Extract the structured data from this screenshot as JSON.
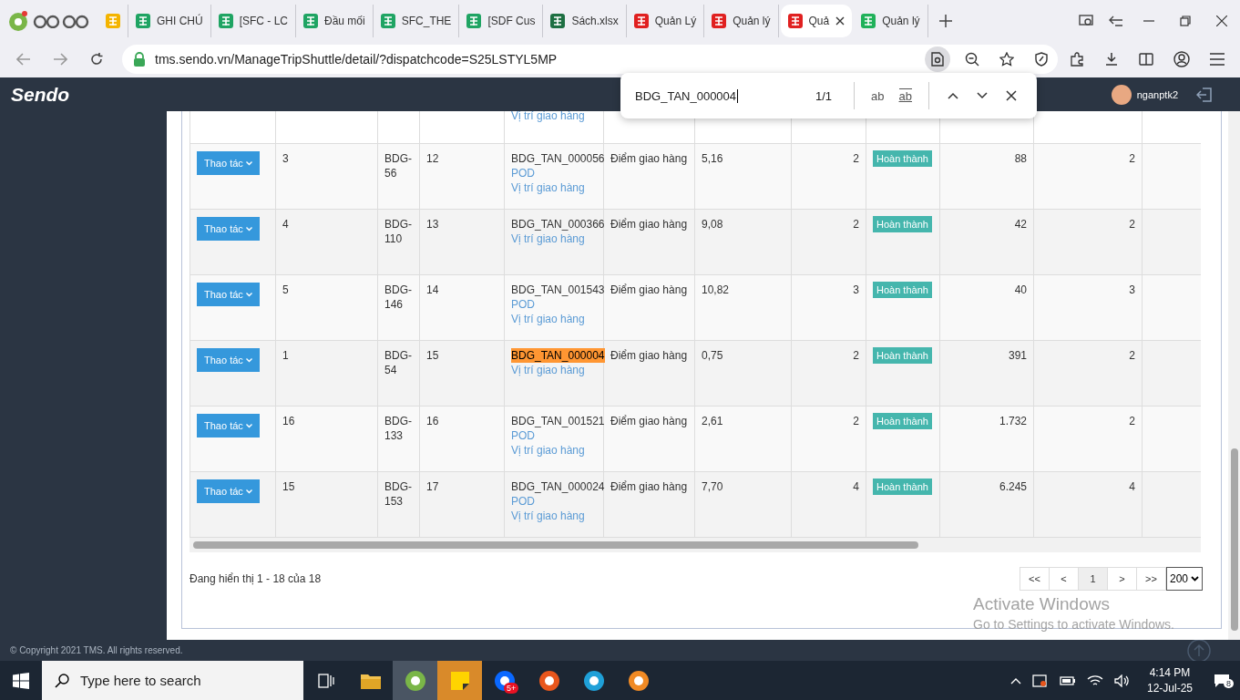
{
  "browser": {
    "tabs": [
      {
        "kind": "drive",
        "selected": false
      },
      {
        "kind": "sheets",
        "title": "GHI CHÚ",
        "selected": false
      },
      {
        "kind": "sheets",
        "title": "[SFC - LC",
        "selected": false
      },
      {
        "kind": "sheets",
        "title": "Đầu mối",
        "selected": false
      },
      {
        "kind": "sheets",
        "title": "SFC_THE",
        "selected": false
      },
      {
        "kind": "sheets",
        "title": "[SDF Cus",
        "selected": false
      },
      {
        "kind": "excel",
        "title": "Sách.xlsx",
        "selected": false
      },
      {
        "kind": "sendo",
        "title": "Quản Lý",
        "selected": false
      },
      {
        "kind": "sendo",
        "title": "Quản lý",
        "selected": false
      },
      {
        "kind": "sendo",
        "title": "Quả",
        "selected": true
      },
      {
        "kind": "green",
        "title": "Quản lý",
        "selected": false
      }
    ],
    "url": "tms.sendo.vn/ManageTripShuttle/detail/?dispatchcode=S25LSTYL5MP"
  },
  "find_bar": {
    "value": "BDG_TAN_000004",
    "count": "1/1",
    "options": [
      "ab",
      "ab"
    ]
  },
  "header": {
    "logo": "Sendo",
    "user": "nganptk2"
  },
  "table": {
    "partial_row": {
      "link": "Vị trí giao hàng"
    },
    "rows": [
      {
        "action": "Thao tác",
        "c2": "3",
        "c3": "BDG-56",
        "c4": "12",
        "code": "BDG_TAN_000056",
        "match": false,
        "links": [
          "POD",
          "Vị trí giao hàng"
        ],
        "type": "Điểm giao hàng",
        "dist": "5,16",
        "c8": "2",
        "status": "Hoàn thành",
        "c10": "88",
        "c11": "2"
      },
      {
        "action": "Thao tác",
        "c2": "4",
        "c3": "BDG-110",
        "c4": "13",
        "code": "BDG_TAN_000366",
        "match": false,
        "links": [
          "Vị trí giao hàng"
        ],
        "type": "Điểm giao hàng",
        "dist": "9,08",
        "c8": "2",
        "status": "Hoàn thành",
        "c10": "42",
        "c11": "2"
      },
      {
        "action": "Thao tác",
        "c2": "5",
        "c3": "BDG-146",
        "c4": "14",
        "code": "BDG_TAN_001543",
        "match": false,
        "links": [
          "POD",
          "Vị trí giao hàng"
        ],
        "type": "Điểm giao hàng",
        "dist": "10,82",
        "c8": "3",
        "status": "Hoàn thành",
        "c10": "40",
        "c11": "3"
      },
      {
        "action": "Thao tác",
        "c2": "1",
        "c3": "BDG-54",
        "c4": "15",
        "code": "BDG_TAN_000004",
        "match": true,
        "links": [
          "Vị trí giao hàng"
        ],
        "type": "Điểm giao hàng",
        "dist": "0,75",
        "c8": "2",
        "status": "Hoàn thành",
        "c10": "391",
        "c11": "2"
      },
      {
        "action": "Thao tác",
        "c2": "16",
        "c3": "BDG-133",
        "c4": "16",
        "code": "BDG_TAN_001521",
        "match": false,
        "links": [
          "POD",
          "Vị trí giao hàng"
        ],
        "type": "Điểm giao hàng",
        "dist": "2,61",
        "c8": "2",
        "status": "Hoàn thành",
        "c10": "1.732",
        "c11": "2"
      },
      {
        "action": "Thao tác",
        "c2": "15",
        "c3": "BDG-153",
        "c4": "17",
        "code": "BDG_TAN_000024",
        "match": false,
        "links": [
          "POD",
          "Vị trí giao hàng"
        ],
        "type": "Điểm giao hàng",
        "dist": "7,70",
        "c8": "4",
        "status": "Hoàn thành",
        "c10": "6.245",
        "c11": "4"
      }
    ]
  },
  "summary": "Đang hiển thị 1 - 18 của 18",
  "pagination": {
    "buttons": [
      {
        "label": "<<",
        "selected": false
      },
      {
        "label": "<",
        "selected": false
      },
      {
        "label": "1",
        "selected": true
      },
      {
        "label": ">",
        "selected": false
      },
      {
        "label": ">>",
        "selected": false
      }
    ],
    "page_size": "200"
  },
  "os_notice": {
    "title": "Activate Windows",
    "text": "Go to Settings to activate Windows."
  },
  "footer": "© Copyright 2021 TMS. All rights reserved.",
  "taskbar": {
    "search_placeholder": "Type here to search",
    "apps": [
      {
        "kind": "taskview",
        "selected": false
      },
      {
        "kind": "folder",
        "selected": false
      },
      {
        "kind": "coccoc",
        "selected": true
      },
      {
        "kind": "sticky",
        "selected": true
      },
      {
        "kind": "zalo",
        "selected": false,
        "badge": "5+"
      },
      {
        "kind": "ring",
        "selected": false
      },
      {
        "kind": "edge",
        "selected": false
      },
      {
        "kind": "cube",
        "selected": false
      }
    ],
    "time": "4:14 PM",
    "date": "12-Jul-25",
    "notifications": "8"
  }
}
